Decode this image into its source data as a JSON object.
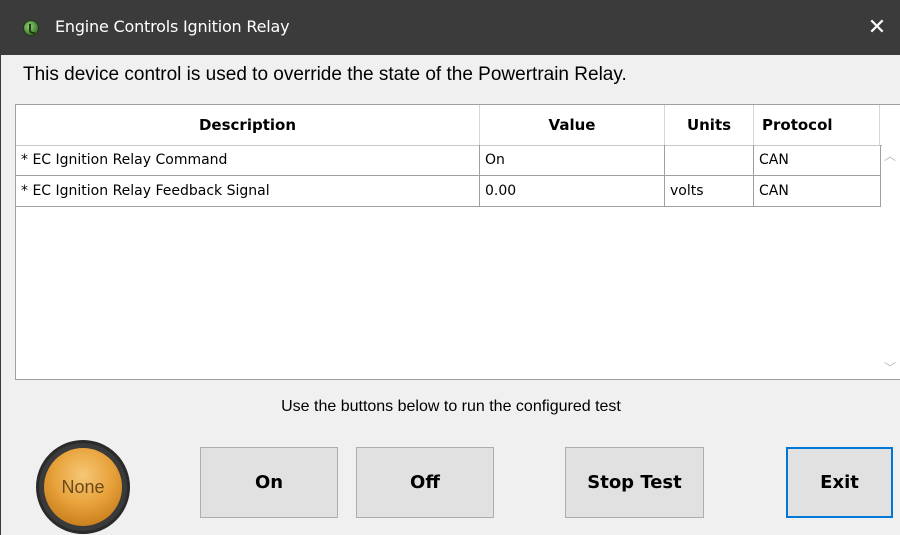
{
  "window": {
    "title": "Engine Controls Ignition Relay",
    "close_glyph": "✕"
  },
  "description": "This device control is used to override the state of the Powertrain Relay.",
  "table": {
    "columns": [
      "Description",
      "Value",
      "Units",
      "Protocol"
    ],
    "rows": [
      {
        "description": "* EC Ignition Relay Command",
        "value": "On",
        "units": "",
        "protocol": "CAN"
      },
      {
        "description": "* EC Ignition Relay Feedback Signal",
        "value": "0.00",
        "units": "volts",
        "protocol": "CAN"
      }
    ]
  },
  "hint": "Use the buttons below to run the configured test",
  "status": {
    "label": "None",
    "color": "#e8a33c"
  },
  "buttons": {
    "on": "On",
    "off": "Off",
    "stop_test": "Stop Test",
    "exit": "Exit"
  },
  "colors": {
    "titlebar": "#3b3b3b",
    "focus_border": "#0078d7"
  }
}
